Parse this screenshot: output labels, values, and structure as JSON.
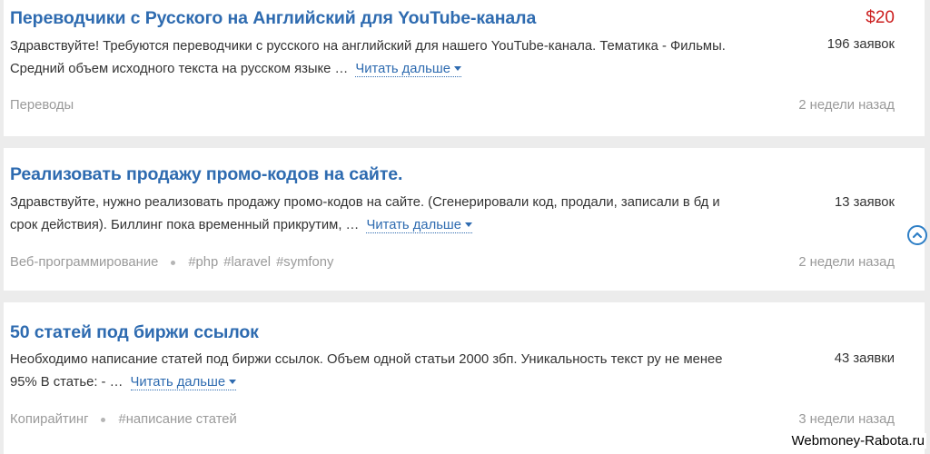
{
  "jobs": [
    {
      "title": "Переводчики с Русского на Английский для YouTube-канала",
      "price": "$20",
      "description": "Здравствуйте! Требуются переводчики с русского на английский для нашего YouTube-канала. Тематика - Фильмы. Средний объем исходного текста на русском языке …",
      "read_more": "Читать дальше",
      "bids": "196 заявок",
      "category": "Переводы",
      "tags": [],
      "time": "2 недели назад"
    },
    {
      "title": "Реализовать продажу промо-кодов на сайте.",
      "price": "",
      "description": "Здравствуйте, нужно реализовать продажу промо-кодов на сайте. (Сгенерировали код, продали, записали в бд и срок действия). Биллинг пока временный прикрутим, …",
      "read_more": "Читать дальше",
      "bids": "13 заявок",
      "category": "Веб-программирование",
      "tags": [
        "#php",
        "#laravel",
        "#symfony"
      ],
      "time": "2 недели назад"
    },
    {
      "title": "50 статей под биржи ссылок",
      "price": "",
      "description": "Необходимо написание статей под биржи ссылок. Объем одной статьи 2000 збп. Уникальность текст ру не менее 95% В статье: - …",
      "read_more": "Читать дальше",
      "bids": "43 заявки",
      "category": "Копирайтинг",
      "tags": [
        "#написание статей"
      ],
      "time": "3 недели назад"
    }
  ],
  "scroll_top_icon": "chevron-up-circle-icon",
  "watermark": "Webmoney-Rabota.ru",
  "colors": {
    "title": "#2e6bb0",
    "price": "#cc1f1f",
    "meta": "#9a9a9a",
    "separator": "#ececec"
  }
}
